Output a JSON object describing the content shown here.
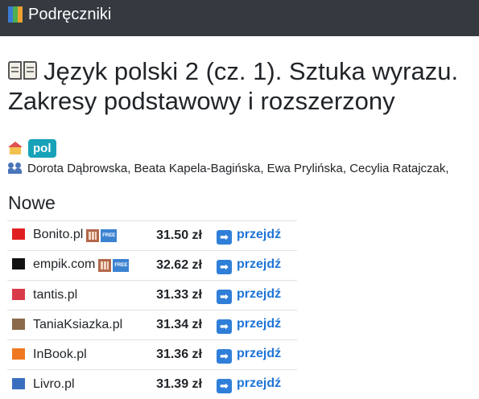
{
  "navbar": {
    "brand": "Podręczniki",
    "brand_icon": "books-icon"
  },
  "book": {
    "title_icon": "open-book-icon",
    "title_line1": "Język polski 2 (cz. 1). Sztuka wyrazu.",
    "title_line2": "Zakresy podstawowy i rozszerzony",
    "school_icon": "school-icon",
    "language": "pol",
    "authors_icon": "people-icon",
    "authors": "Dorota Dąbrowska, Beata Kapela-Bagińska, Ewa Prylińska, Cecylia Ratajczak,"
  },
  "offers_section": {
    "heading": "Nowe",
    "go_label": "przejdź",
    "currency": "zł",
    "rows": [
      {
        "shop": "Bonito.pl",
        "icon_color": "#e02020",
        "price": "31.50 zł",
        "extras": true
      },
      {
        "shop": "empik.com",
        "icon_color": "#111111",
        "price": "32.62 zł",
        "extras": true
      },
      {
        "shop": "tantis.pl",
        "icon_color": "#d83a4a",
        "price": "31.33 zł",
        "extras": false
      },
      {
        "shop": "TaniaKsiazka.pl",
        "icon_color": "#8a6a4a",
        "price": "31.34 zł",
        "extras": false
      },
      {
        "shop": "InBook.pl",
        "icon_color": "#f07820",
        "price": "31.36 zł",
        "extras": false
      },
      {
        "shop": "Livro.pl",
        "icon_color": "#3a6fbf",
        "price": "31.39 zł",
        "extras": false
      }
    ]
  }
}
